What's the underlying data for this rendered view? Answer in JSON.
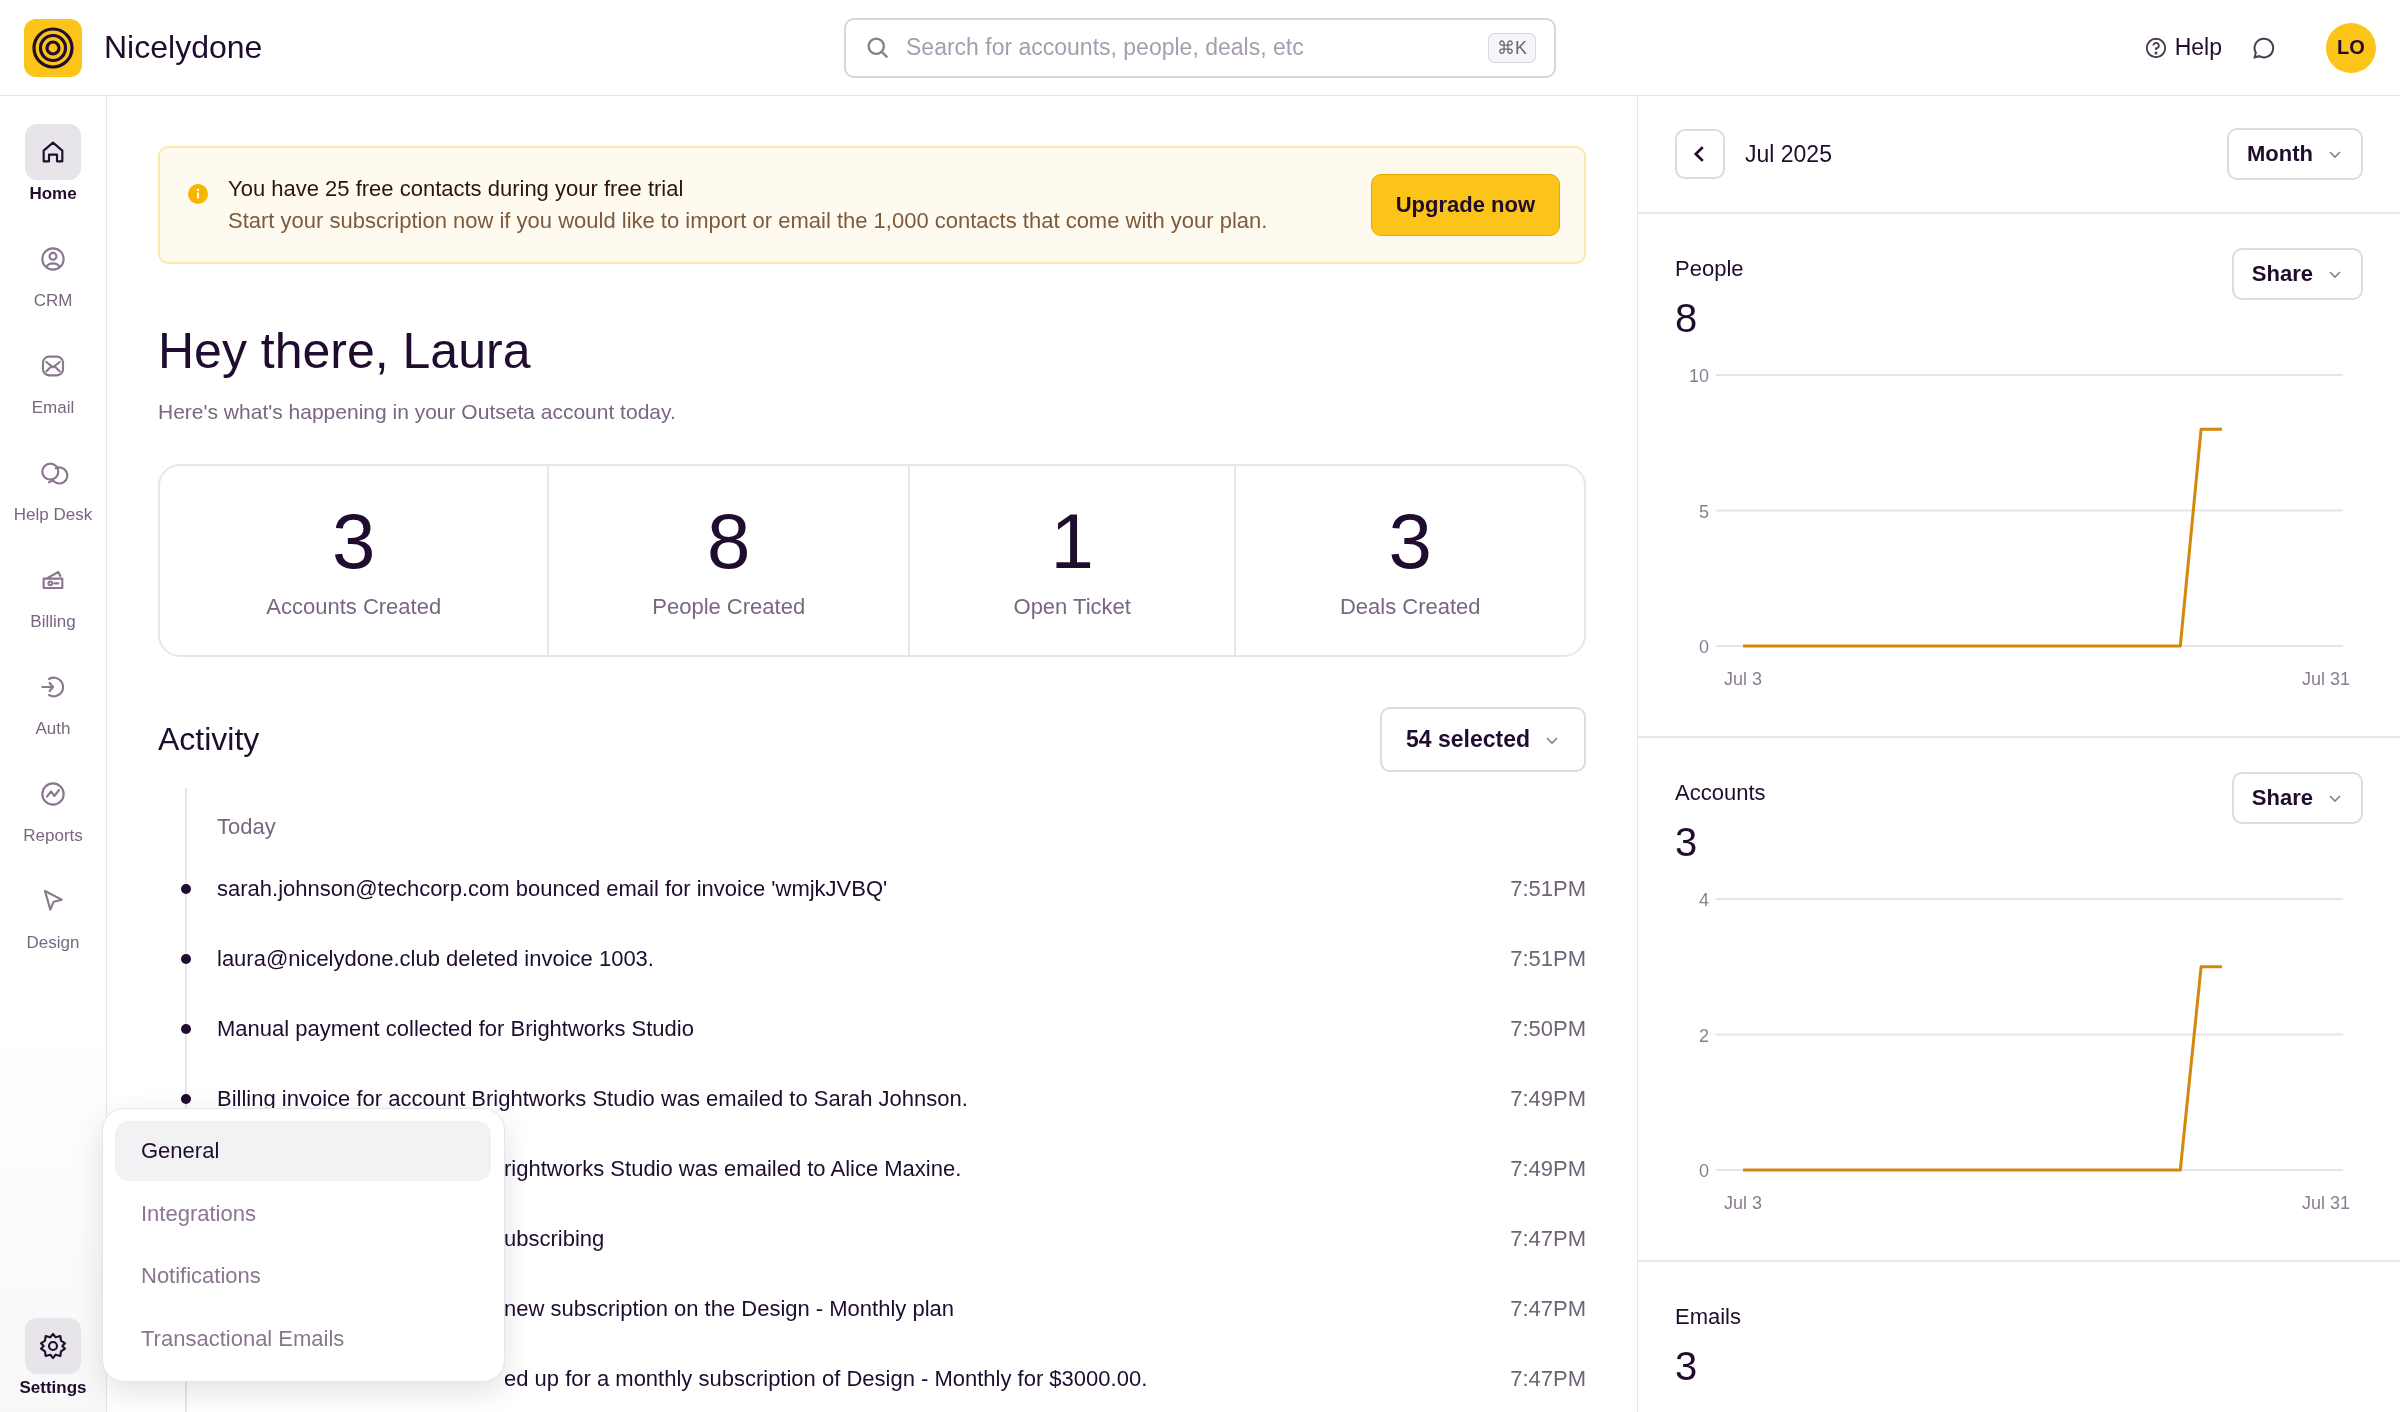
{
  "app": {
    "brand": "Nicelydone"
  },
  "search": {
    "placeholder": "Search for accounts, people, deals, etc",
    "shortcut": "⌘K"
  },
  "header_actions": {
    "help": "Help",
    "avatar": "LO"
  },
  "sidebar": {
    "items": [
      {
        "label": "Home",
        "selected": true
      },
      {
        "label": "CRM",
        "selected": false
      },
      {
        "label": "Email",
        "selected": false
      },
      {
        "label": "Help Desk",
        "selected": false
      },
      {
        "label": "Billing",
        "selected": false
      },
      {
        "label": "Auth",
        "selected": false
      },
      {
        "label": "Reports",
        "selected": false
      },
      {
        "label": "Design",
        "selected": false
      }
    ],
    "settings": {
      "label": "Settings",
      "menu_open": true
    }
  },
  "settings_menu": [
    {
      "label": "General",
      "selected": true
    },
    {
      "label": "Integrations",
      "selected": false
    },
    {
      "label": "Notifications",
      "selected": false
    },
    {
      "label": "Transactional Emails",
      "selected": false
    }
  ],
  "banner": {
    "title": "You have 25 free contacts during your free trial",
    "text": "Start your subscription now if you would like to import or email the 1,000 contacts that come with your plan.",
    "button": "Upgrade now"
  },
  "greeting": {
    "title": "Hey there, Laura",
    "subtitle": "Here's what's happening in your Outseta account today."
  },
  "stats": [
    {
      "value": "3",
      "label": "Accounts Created"
    },
    {
      "value": "8",
      "label": "People Created"
    },
    {
      "value": "1",
      "label": "Open Ticket"
    },
    {
      "value": "3",
      "label": "Deals Created"
    }
  ],
  "activity": {
    "title": "Activity",
    "filter": "54 selected",
    "day": "Today",
    "items": [
      {
        "text": "sarah.johnson@techcorp.com bounced email for invoice 'wmjkJVBQ'",
        "time": "7:51PM",
        "partly_hidden": false
      },
      {
        "text": "laura@nicelydone.club deleted invoice 1003.",
        "time": "7:51PM",
        "partly_hidden": false
      },
      {
        "text": "Manual payment collected for Brightworks Studio",
        "time": "7:50PM",
        "partly_hidden": false
      },
      {
        "text": "Billing invoice for account Brightworks Studio was emailed to Sarah Johnson.",
        "time": "7:49PM",
        "partly_hidden": false
      },
      {
        "text": "rightworks Studio was emailed to Alice Maxine.",
        "time": "7:49PM",
        "partly_hidden": true
      },
      {
        "text": "ubscribing",
        "time": "7:47PM",
        "partly_hidden": true
      },
      {
        "text": "new subscription on the Design - Monthly plan",
        "time": "7:47PM",
        "partly_hidden": true
      },
      {
        "text": "ed up for a monthly subscription of Design - Monthly for $3000.00.",
        "time": "7:47PM",
        "partly_hidden": true
      }
    ]
  },
  "right_panel": {
    "period": "Jul 2025",
    "range": "Month",
    "metrics": [
      {
        "title": "People",
        "value": "8",
        "button": "Share",
        "chart_data": {
          "type": "line",
          "categories": [
            "Jul 3",
            null,
            null,
            null,
            null,
            null,
            null,
            null,
            null,
            null,
            null,
            null,
            null,
            null,
            null,
            null,
            null,
            null,
            null,
            null,
            null,
            null,
            null,
            null,
            null,
            null,
            null,
            null,
            "Jul 31"
          ],
          "ylim": [
            0,
            10
          ],
          "yticks": [
            0,
            5,
            10
          ],
          "series": [
            {
              "color": "#d4870a",
              "values": [
                0,
                0,
                0,
                0,
                0,
                0,
                0,
                0,
                0,
                0,
                0,
                0,
                0,
                0,
                0,
                0,
                0,
                0,
                0,
                0,
                0,
                0,
                8,
                8,
                null,
                null,
                null,
                null,
                null
              ]
            }
          ]
        }
      },
      {
        "title": "Accounts",
        "value": "3",
        "button": "Share",
        "chart_data": {
          "type": "line",
          "categories": [
            "Jul 3",
            null,
            null,
            null,
            null,
            null,
            null,
            null,
            null,
            null,
            null,
            null,
            null,
            null,
            null,
            null,
            null,
            null,
            null,
            null,
            null,
            null,
            null,
            null,
            null,
            null,
            null,
            null,
            "Jul 31"
          ],
          "ylim": [
            0,
            4
          ],
          "yticks": [
            0,
            2,
            4
          ],
          "series": [
            {
              "color": "#d4870a",
              "values": [
                0,
                0,
                0,
                0,
                0,
                0,
                0,
                0,
                0,
                0,
                0,
                0,
                0,
                0,
                0,
                0,
                0,
                0,
                0,
                0,
                0,
                0,
                3,
                3,
                null,
                null,
                null,
                null,
                null
              ]
            }
          ]
        }
      },
      {
        "title": "Emails",
        "value": "3"
      }
    ]
  }
}
